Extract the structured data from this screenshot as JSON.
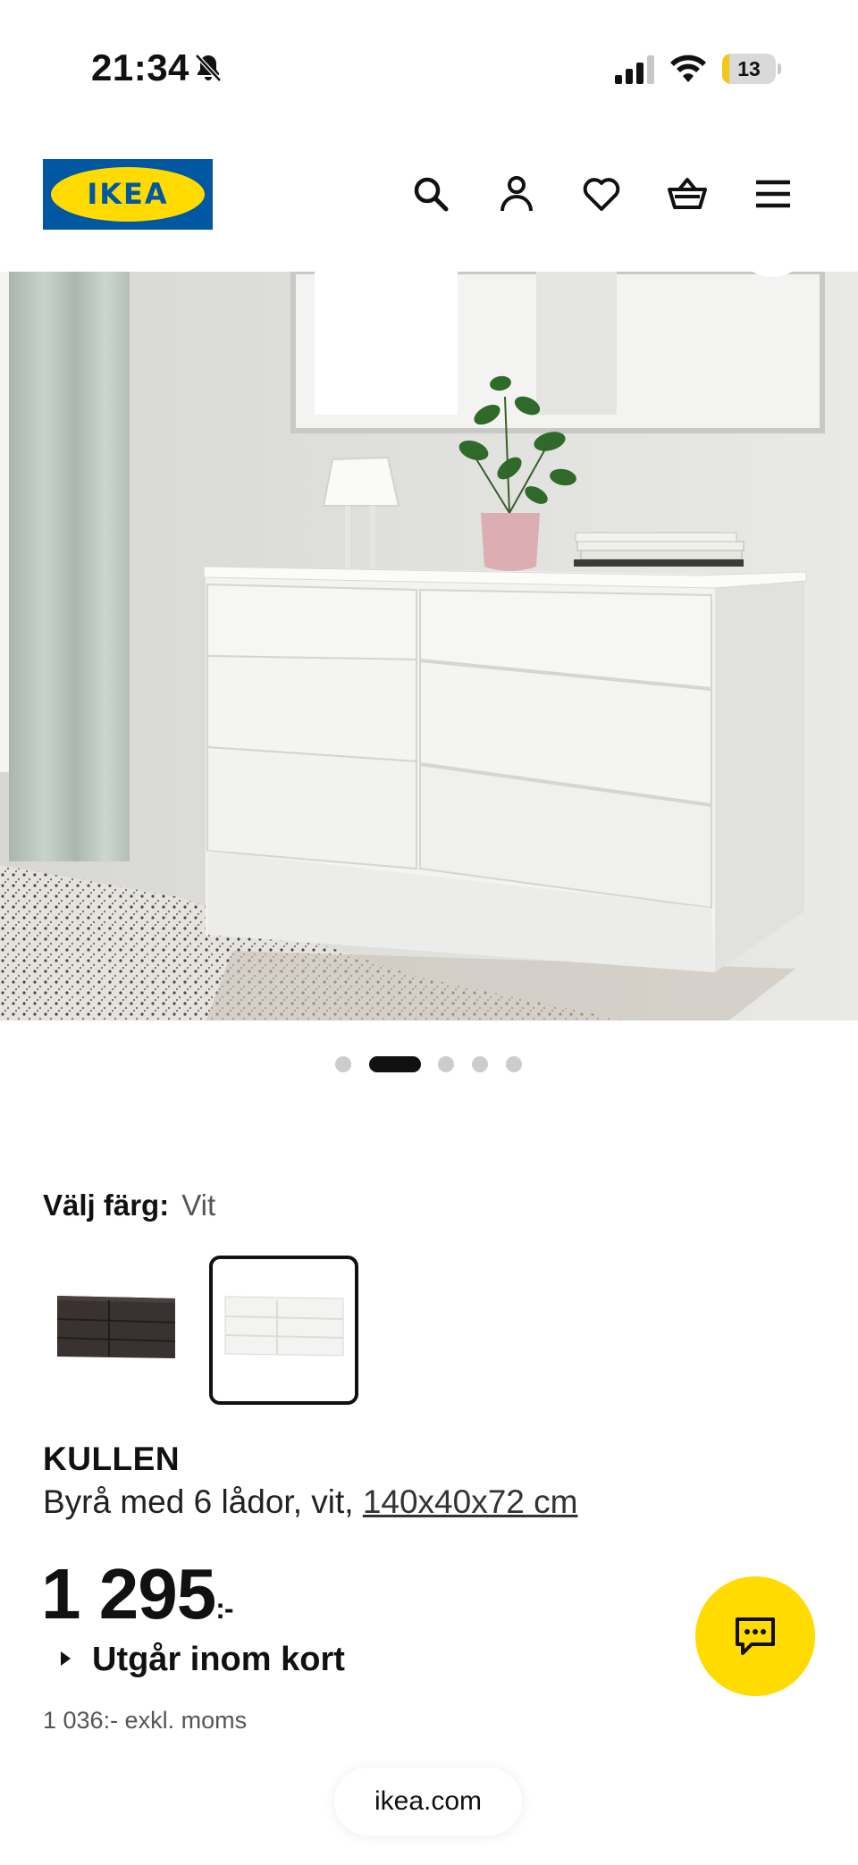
{
  "status_bar": {
    "time": "21:34",
    "battery_level": "13",
    "battery_fraction": 0.13,
    "icons": [
      "bell-off-icon",
      "signal-icon",
      "wifi-icon",
      "battery-icon"
    ]
  },
  "header": {
    "logo_text": "IKEA",
    "icons": [
      "search-icon",
      "account-icon",
      "heart-icon",
      "basket-icon",
      "menu-icon"
    ]
  },
  "gallery": {
    "image_count": 5,
    "active_index": 1
  },
  "product": {
    "color_label": "Välj färg:",
    "color_value": "Vit",
    "swatches": [
      {
        "color": "dark-brown",
        "selected": false
      },
      {
        "color": "white",
        "selected": true
      }
    ],
    "name": "KULLEN",
    "description": "Byrå med 6 lådor, vit, ",
    "size": "140x40x72 cm",
    "price": "1 295",
    "price_suffix": ":-",
    "availability": "Utgår inom kort",
    "price_excl_vat": "1 036:- exkl. moms"
  },
  "chat": {
    "icon": "chat-icon"
  },
  "browser": {
    "url": "ikea.com"
  },
  "colors": {
    "ikea_blue": "#0058a3",
    "ikea_yellow": "#ffdb00",
    "text": "#111111"
  }
}
